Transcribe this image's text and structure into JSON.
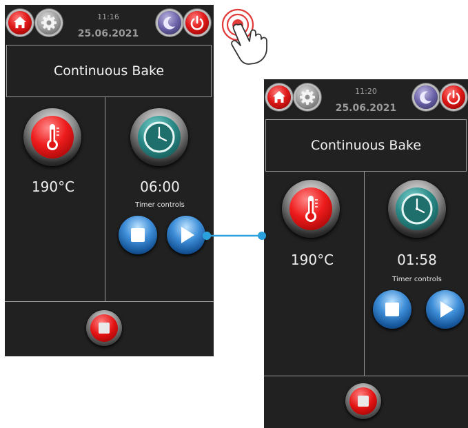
{
  "screens": [
    {
      "time": "11:16",
      "date": "25.06.2021",
      "program": "Continuous Bake",
      "temperature": "190°C",
      "timer": "06:00",
      "timer_controls_label": "Timer controls"
    },
    {
      "time": "11:20",
      "date": "25.06.2021",
      "program": "Continuous Bake",
      "temperature": "190°C",
      "timer": "01:58",
      "timer_controls_label": "Timer controls"
    }
  ],
  "icons": {
    "home": "home-icon",
    "settings": "gear-icon",
    "night": "moon-icon",
    "power": "power-icon",
    "temperature": "thermometer-icon",
    "timer": "clock-icon",
    "stop": "stop-icon",
    "play": "play-icon",
    "tap_gesture": "tap-hand-icon"
  },
  "colors": {
    "background": "#212121",
    "red": "#e11919",
    "teal": "#2b8b88",
    "blue": "#3f8fd9",
    "connector": "#2aa0dc"
  }
}
